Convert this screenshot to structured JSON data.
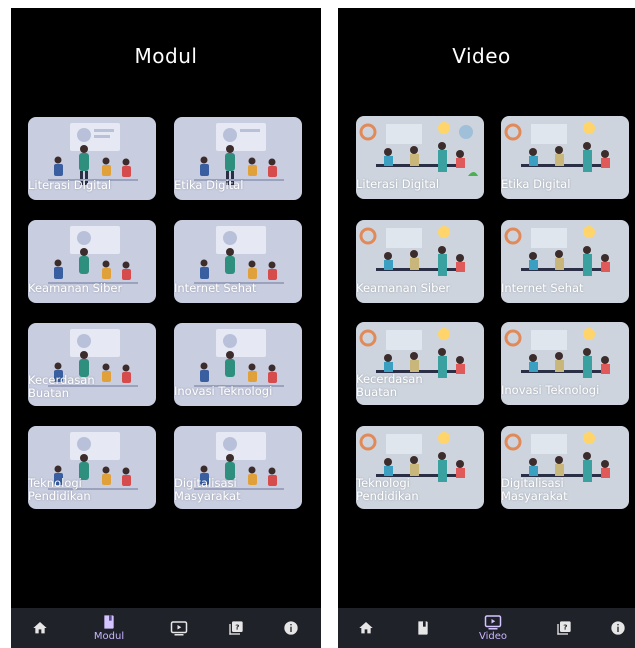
{
  "screens": [
    {
      "title": "Modul",
      "cards": [
        {
          "label": "Literasi Digital"
        },
        {
          "label": "Etika Digital"
        },
        {
          "label": "Keamanan Siber"
        },
        {
          "label": "Internet Sehat"
        },
        {
          "label": "Kecerdasan\nBuatan"
        },
        {
          "label": "Inovasi Teknologi"
        },
        {
          "label": "Teknologi\nPendidikan"
        },
        {
          "label": "Digitalisasi\nMasyarakat"
        }
      ],
      "nav": {
        "active_label": "Modul"
      }
    },
    {
      "title": "Video",
      "cards": [
        {
          "label": "Literasi Digital"
        },
        {
          "label": "Etika Digital"
        },
        {
          "label": "Keamanan Siber"
        },
        {
          "label": "Internet Sehat"
        },
        {
          "label": "Kecerdasan\nBuatan"
        },
        {
          "label": "Inovasi Teknologi"
        },
        {
          "label": "Teknologi\nPendidikan"
        },
        {
          "label": "Digitalisasi\nMasyarakat"
        }
      ],
      "nav": {
        "active_label": "Video"
      }
    }
  ],
  "nav_icons": [
    "home-icon",
    "book-icon",
    "video-play-icon",
    "quiz-icon",
    "info-icon"
  ],
  "colors": {
    "background": "#000000",
    "nav_bg": "#20222a",
    "accent": "#c9b6ff",
    "modul_card_bg": "#c8cde0",
    "video_card_bg": "#cdd4de"
  }
}
